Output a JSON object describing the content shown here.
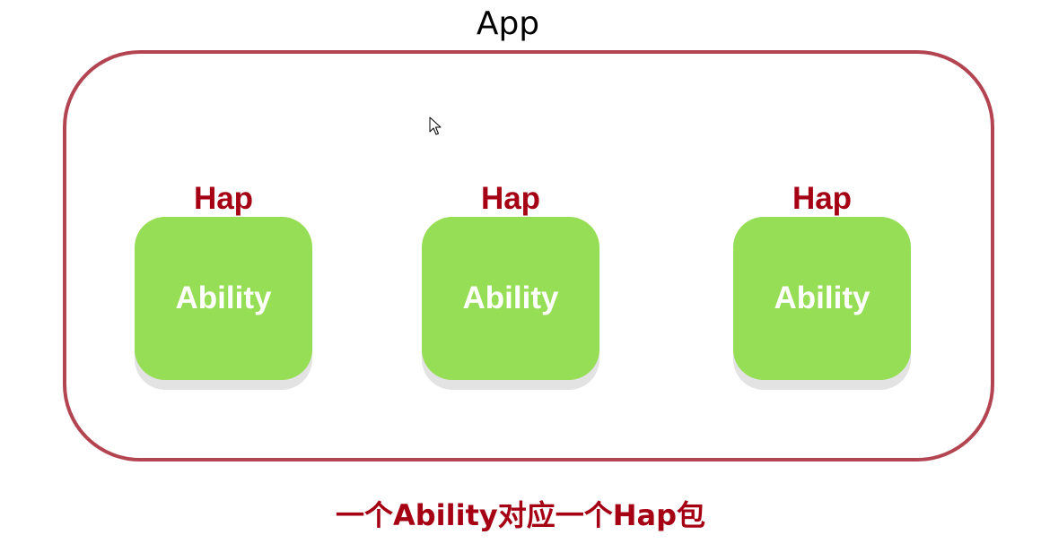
{
  "app": {
    "title": "App"
  },
  "modules": [
    {
      "hap_label": "Hap",
      "ability_label": "Ability"
    },
    {
      "hap_label": "Hap",
      "ability_label": "Ability"
    },
    {
      "hap_label": "Hap",
      "ability_label": "Ability"
    }
  ],
  "caption": "一个Ability对应一个Hap包",
  "colors": {
    "frame_border": "#b34552",
    "hap_text": "#a50013",
    "ability_fill": "#96de55",
    "ability_shadow": "#e3e3e3",
    "ability_text": "#ffffff",
    "caption_text": "#a50013"
  },
  "icons": {
    "cursor": "mouse-pointer-icon"
  }
}
